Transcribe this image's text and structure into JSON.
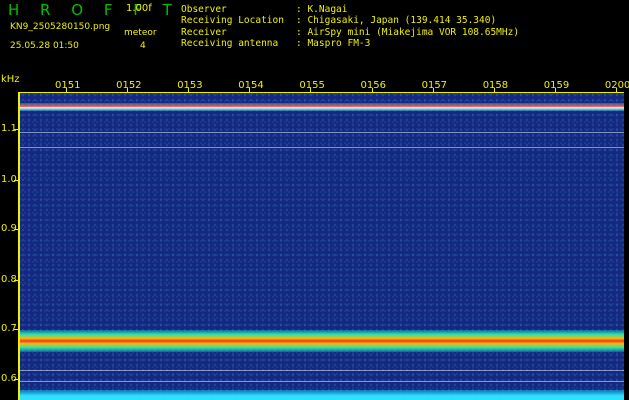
{
  "header": {
    "app_name": "H R O F F T",
    "version": "1.00f",
    "filename": "KN9_2505280150.png",
    "meteor_label": "meteor",
    "meteor_count": "4",
    "datetime": "25.05.28 01:50"
  },
  "metadata": [
    {
      "key": "Observer",
      "value": ": K.Nagai"
    },
    {
      "key": "Receiving Location",
      "value": ": Chigasaki, Japan (139.414 35.340)"
    },
    {
      "key": "Receiver",
      "value": ": AirSpy mini (Miakejima VOR 108.65MHz)"
    },
    {
      "key": "Receiving antenna",
      "value": ": Maspro FM-3"
    }
  ],
  "chart_data": {
    "type": "heatmap",
    "ylabel": "kHz",
    "x_tick_labels": [
      "0151",
      "0152",
      "0153",
      "0154",
      "0155",
      "0156",
      "0157",
      "0158",
      "0159",
      "0200"
    ],
    "y_tick_labels": [
      "1.1",
      "1.0",
      "0.9",
      "0.8",
      "0.7",
      "0.6"
    ],
    "ylim": [
      0.58,
      1.18
    ],
    "features": [
      {
        "name": "upper carrier",
        "freq_khz": 1.14
      },
      {
        "name": "lower band",
        "freq_khz": 0.68
      }
    ],
    "colors": {
      "background": "#142880",
      "axis": "#f0f000",
      "peak": "#ff3030"
    }
  }
}
